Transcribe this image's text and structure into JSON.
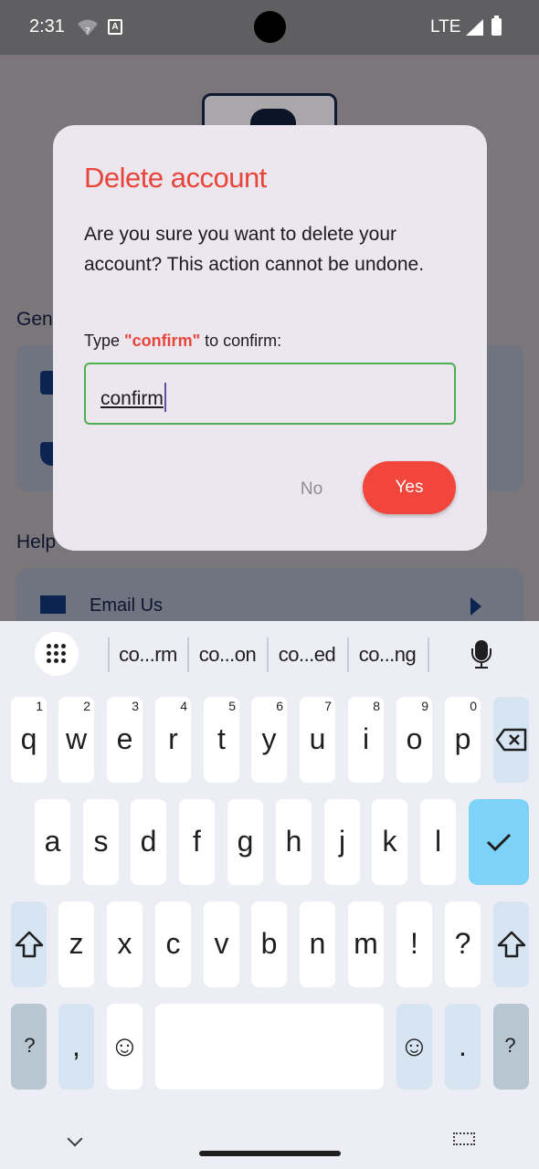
{
  "status_bar": {
    "time": "2:31",
    "notification_icon": "A",
    "network": "LTE"
  },
  "background_app": {
    "section_general": "Gen",
    "section_help": "Help",
    "email_label": "Email Us"
  },
  "dialog": {
    "title": "Delete account",
    "message": "Are you sure you want to delete your account? This action cannot be undone.",
    "hint_prefix": "Type ",
    "hint_keyword": "\"confirm\"",
    "hint_suffix": " to confirm:",
    "input_value": "confirm",
    "no_label": "No",
    "yes_label": "Yes",
    "accent_color": "#e8453a",
    "input_border_color": "#4caf50"
  },
  "keyboard": {
    "suggestions": [
      "co...rm",
      "co...on",
      "co...ed",
      "co...ng"
    ],
    "row1": [
      {
        "key": "q",
        "hint": "1"
      },
      {
        "key": "w",
        "hint": "2"
      },
      {
        "key": "e",
        "hint": "3"
      },
      {
        "key": "r",
        "hint": "4"
      },
      {
        "key": "t",
        "hint": "5"
      },
      {
        "key": "y",
        "hint": "6"
      },
      {
        "key": "u",
        "hint": "7"
      },
      {
        "key": "i",
        "hint": "8"
      },
      {
        "key": "o",
        "hint": "9"
      },
      {
        "key": "p",
        "hint": "0"
      }
    ],
    "row2": [
      "a",
      "s",
      "d",
      "f",
      "g",
      "h",
      "j",
      "k",
      "l"
    ],
    "row3": [
      "z",
      "x",
      "c",
      "v",
      "b",
      "n",
      "m",
      "!",
      "?"
    ],
    "symbols_label": "?123",
    "comma_label": ",",
    "period_label": ".",
    "emoji_icon": "☺"
  }
}
